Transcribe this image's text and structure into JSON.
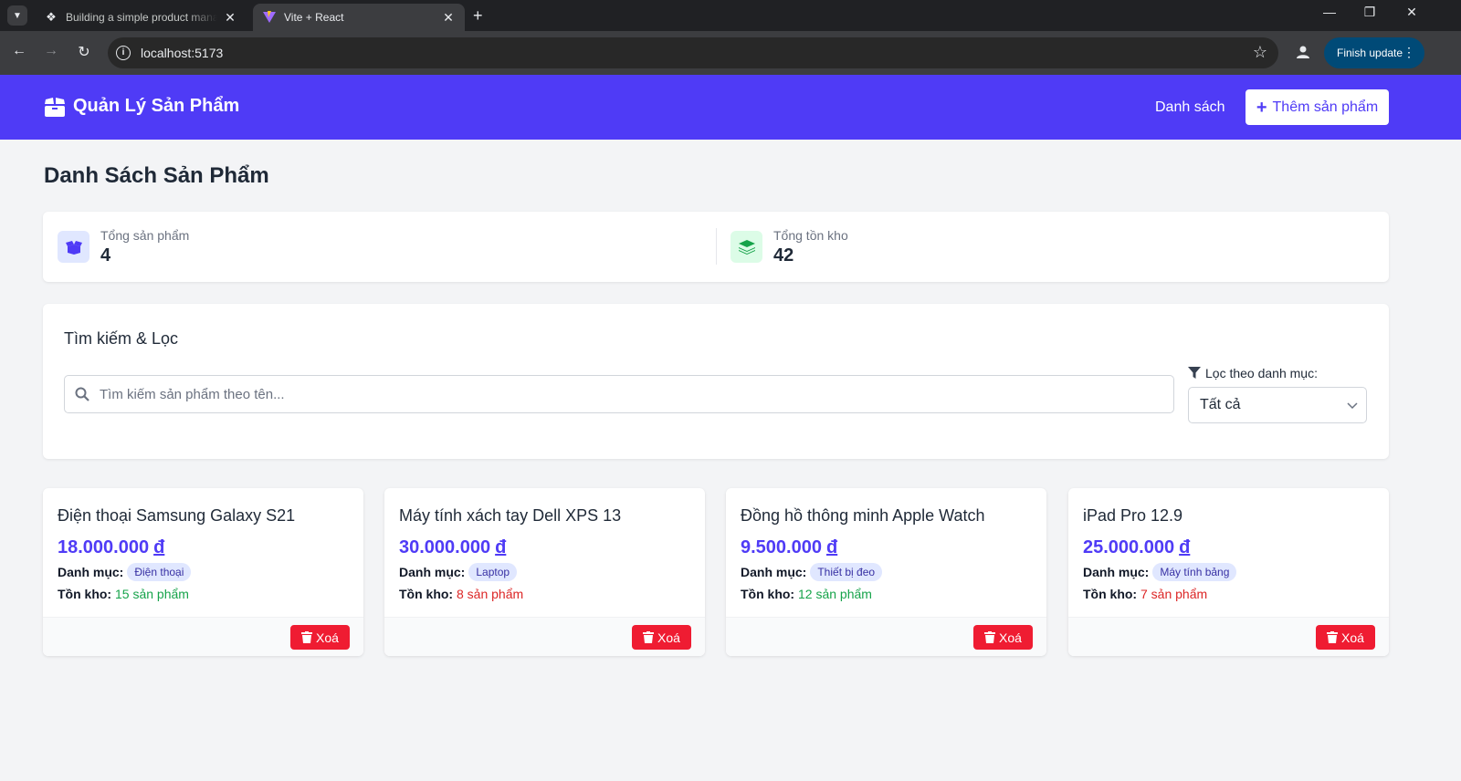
{
  "browser": {
    "tabs": [
      {
        "title": "Building a simple product mana",
        "active": false
      },
      {
        "title": "Vite + React",
        "active": true
      }
    ],
    "url": "localhost:5173",
    "finish_update_label": "Finish update"
  },
  "header": {
    "brand": "Quản Lý Sản Phẩm",
    "nav_list": "Danh sách",
    "add_button": "Thêm sản phẩm",
    "color": "#4f3bf6"
  },
  "page": {
    "title": "Danh Sách Sản Phẩm"
  },
  "stats": {
    "total_products": {
      "label": "Tổng sản phẩm",
      "value": "4"
    },
    "total_stock": {
      "label": "Tổng tồn kho",
      "value": "42"
    }
  },
  "filter": {
    "title": "Tìm kiếm & Lọc",
    "search_placeholder": "Tìm kiếm sản phẩm theo tên...",
    "category_label": "Lọc theo danh mục:",
    "category_selected": "Tất cả"
  },
  "product_labels": {
    "category": "Danh mục:",
    "stock": "Tồn kho:",
    "delete": "Xoá",
    "currency": "đ"
  },
  "products": [
    {
      "name": "Điện thoại Samsung Galaxy S21",
      "price": "18.000.000",
      "category": "Điện thoại",
      "stock": "15 sản phẩm",
      "stock_color": "#16a34a"
    },
    {
      "name": "Máy tính xách tay Dell XPS 13",
      "price": "30.000.000",
      "category": "Laptop",
      "stock": "8 sản phẩm",
      "stock_color": "#dc2626"
    },
    {
      "name": "Đồng hồ thông minh Apple Watch",
      "price": "9.500.000",
      "category": "Thiết bị đeo",
      "stock": "12 sản phẩm",
      "stock_color": "#16a34a"
    },
    {
      "name": "iPad Pro 12.9",
      "price": "25.000.000",
      "category": "Máy tính bảng",
      "stock": "7 sản phẩm",
      "stock_color": "#dc2626"
    }
  ]
}
